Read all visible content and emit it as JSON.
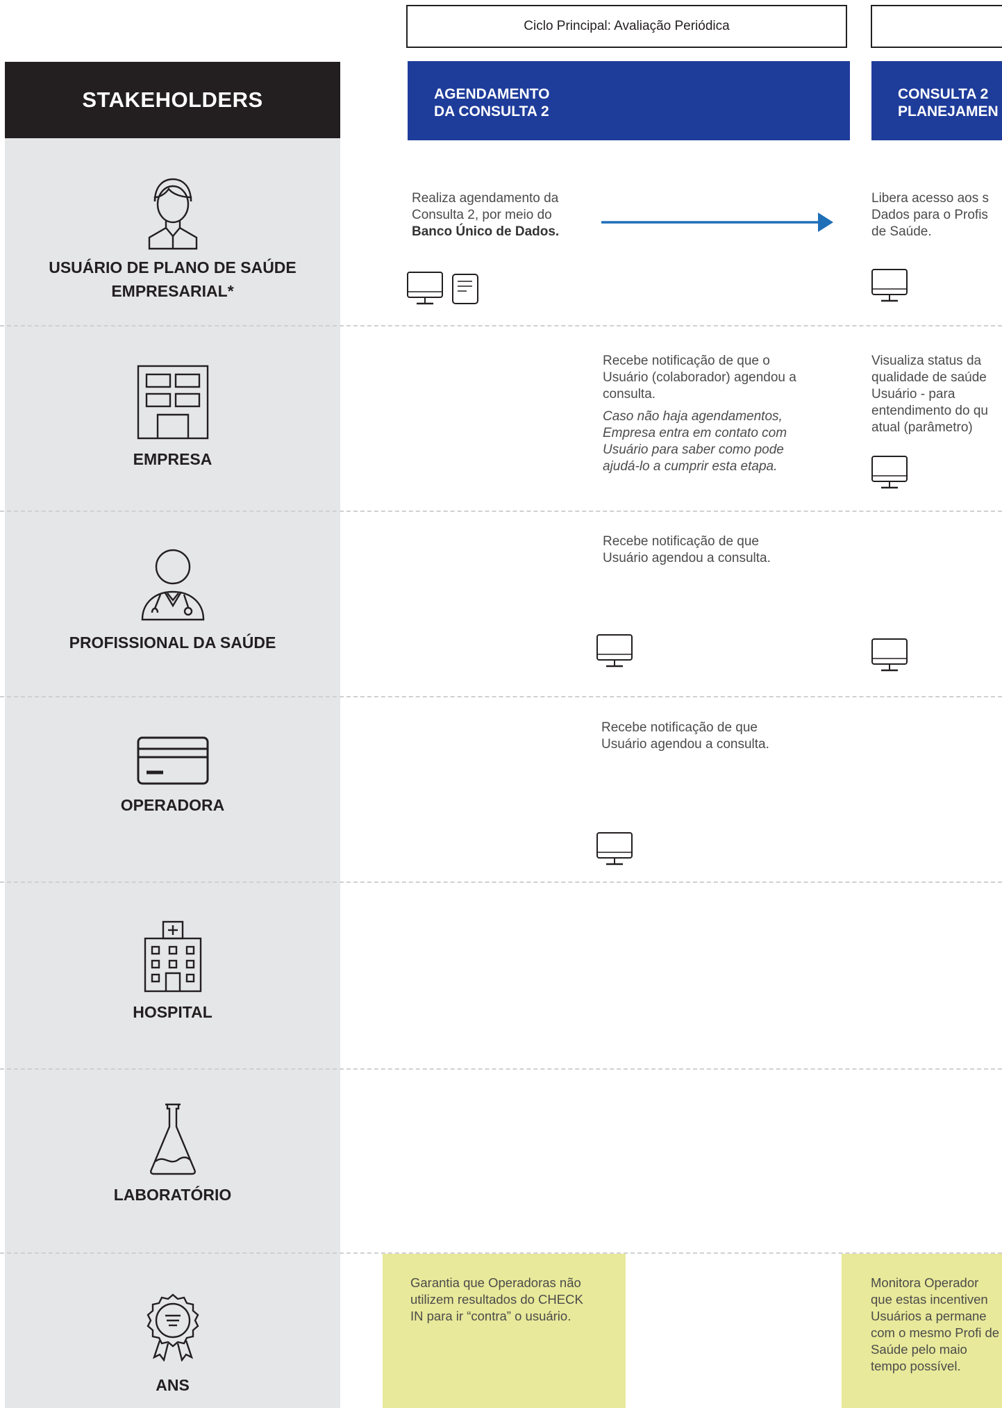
{
  "header": {
    "cycle_label": "Ciclo Principal: Avaliação Periódica",
    "stakeholders_title": "STAKEHOLDERS",
    "phases": [
      {
        "line1": "AGENDAMENTO",
        "line2": "DA CONSULTA 2"
      },
      {
        "line1": "CONSULTA 2",
        "line2": "PLANEJAMEN"
      }
    ]
  },
  "stakeholders": [
    {
      "name_line1": "USUÁRIO DE PLANO DE SAÚDE",
      "name_line2": "EMPRESARIAL*",
      "icon": "user-icon"
    },
    {
      "name_line1": "EMPRESA",
      "icon": "building-icon"
    },
    {
      "name_line1": "PROFISSIONAL DA SAÚDE",
      "icon": "doctor-icon"
    },
    {
      "name_line1": "OPERADORA",
      "icon": "credit-card-icon"
    },
    {
      "name_line1": "HOSPITAL",
      "icon": "hospital-icon"
    },
    {
      "name_line1": "LABORATÓRIO",
      "icon": "flask-icon"
    },
    {
      "name_line1": "ANS",
      "icon": "seal-icon"
    }
  ],
  "cells": {
    "usuario_agendamento": {
      "text": "Realiza agendamento da Consulta 2, por meio do",
      "bold": "Banco Único de Dados."
    },
    "usuario_consulta": {
      "text": "Libera acesso aos s Dados para o Profis de Saúde."
    },
    "empresa_agendamento": {
      "text": "Recebe notificação de que o Usuário (colaborador) agendou a consulta.",
      "italic": "Caso não haja agendamentos, Empresa entra em contato com Usuário para saber como pode ajudá-lo a cumprir esta etapa."
    },
    "empresa_consulta": {
      "text": "Visualiza status da qualidade de saúde Usuário - para entendimento do qu atual (parâmetro)"
    },
    "profissional_agendamento": {
      "text": "Recebe notificação de que Usuário agendou a consulta."
    },
    "operadora_agendamento": {
      "text": "Recebe notificação de que Usuário agendou a consulta."
    },
    "ans_agendamento": {
      "text": "Garantia que Operadoras não utilizem resultados do CHECK IN para ir “contra” o usuário."
    },
    "ans_consulta": {
      "text": "Monitora Operador que estas incentiven Usuários a permane com o mesmo Profi de Saúde pelo maio tempo possível."
    }
  },
  "colors": {
    "phase_blue": "#1e3c9a",
    "arrow_blue": "#1f6fb8",
    "sidebar_gray": "#e5e6e8",
    "ans_yellow": "#e8e99a",
    "dark": "#231f20"
  }
}
